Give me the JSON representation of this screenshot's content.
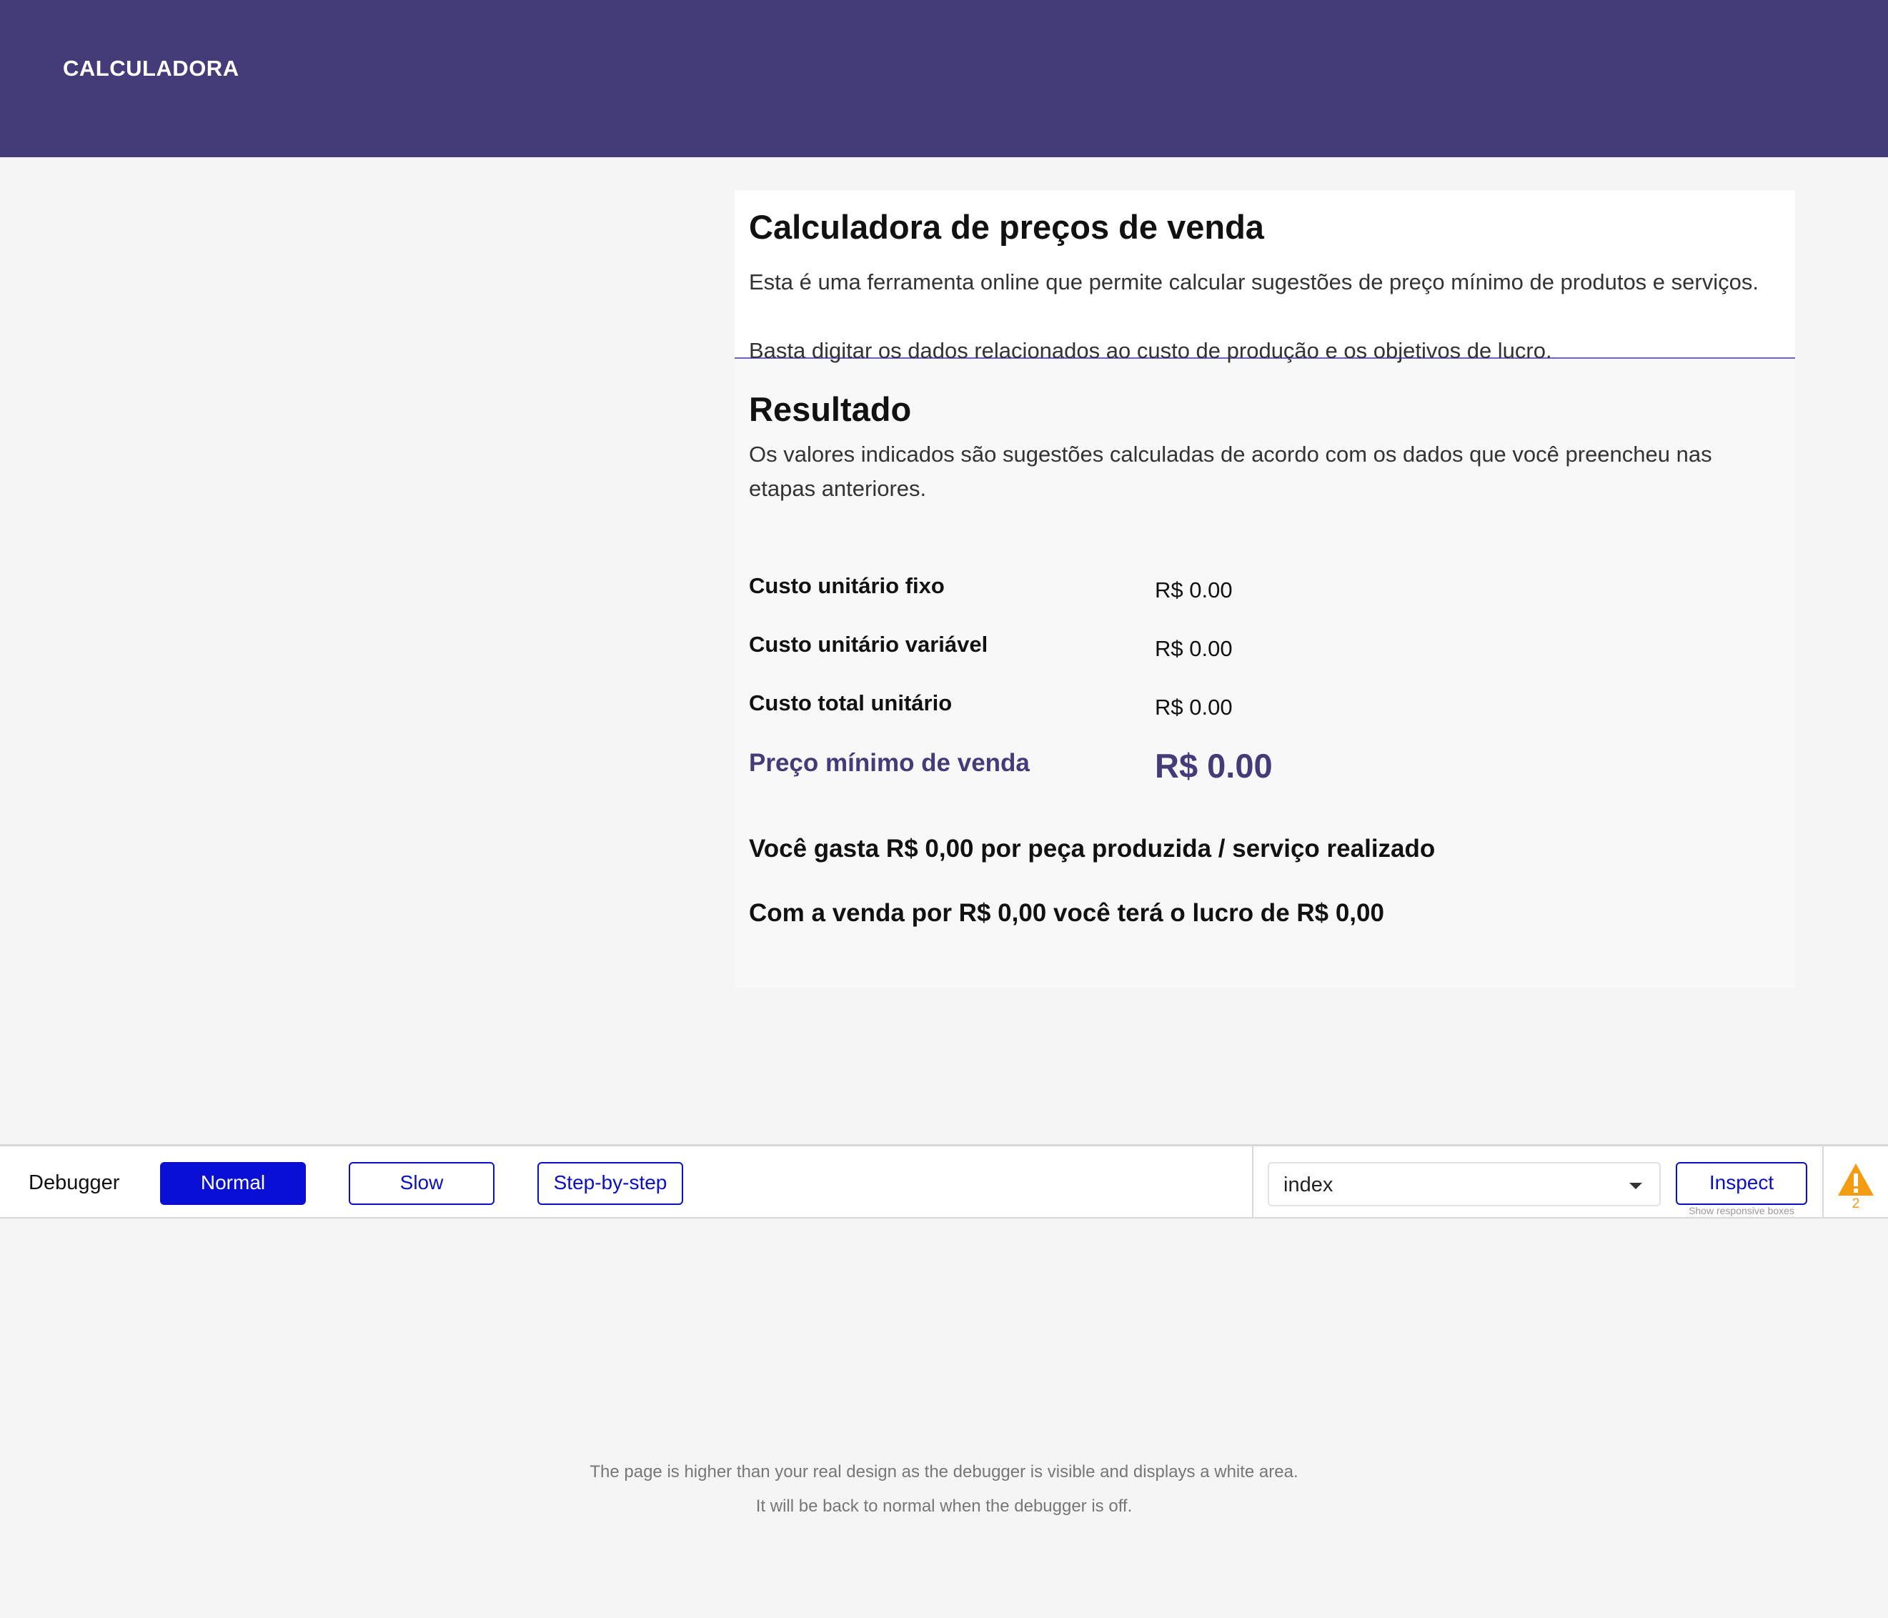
{
  "header": {
    "brand": "CALCULADORA",
    "color": "#443c79"
  },
  "intro": {
    "title": "Calculadora de preços de venda",
    "paragraph_1": "Esta é uma ferramenta online que permite calcular sugestões de preço mínimo de produtos e serviços.",
    "paragraph_2": "Basta digitar os dados relacionados ao custo de produção e os objetivos de lucro."
  },
  "result": {
    "title": "Resultado",
    "description": "Os valores indicados são sugestões calculadas de acordo com os dados que você preencheu nas etapas anteriores.",
    "rows": [
      {
        "label": "Custo unitário fixo",
        "value": "R$ 0.00"
      },
      {
        "label": "Custo unitário variável",
        "value": "R$ 0.00"
      },
      {
        "label": "Custo total unitário",
        "value": "R$ 0.00"
      },
      {
        "label": "Preço mínimo de venda",
        "value": "R$ 0.00"
      }
    ],
    "summary_1": "Você gasta R$ 0,00 por peça produzida / serviço realizado",
    "summary_2": "Com a venda por R$  0,00 você terá o lucro de R$ 0,00"
  },
  "debugger": {
    "label": "Debugger",
    "modes": [
      "Normal",
      "Slow",
      "Step-by-step"
    ],
    "active_mode": "Normal",
    "page_select": "index",
    "inspect_label": "Inspect",
    "inspect_hint": "Show responsive boxes",
    "warning_icon": "warning-triangle-icon",
    "warning_count": "2",
    "accent": "#0a10c6"
  },
  "footnote": {
    "line_1": "The page is higher than your real design as the debugger is visible and displays a white area.",
    "line_2": "It will be back to normal when the debugger is off."
  }
}
